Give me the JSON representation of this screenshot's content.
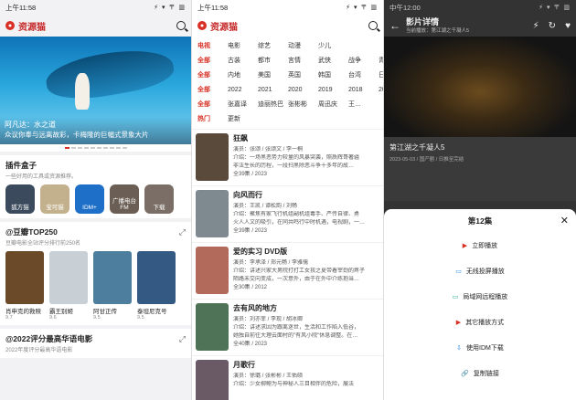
{
  "home": {
    "status_time": "上午11:58",
    "status_right": "⚡ ▾ 〒 ▥",
    "app_title": "资源猫",
    "banner": {
      "title": "阿凡达：水之道",
      "subtitle": "众议你奉与远离故彩，卡梅隆的巨幅式景象大片"
    },
    "plugins": {
      "title": "插件盒子",
      "sub": "一些好用的工具或资源推荐。",
      "items": [
        {
          "label": "狐方猫",
          "color": "#3b4a5c"
        },
        {
          "label": "宝可猫",
          "color": "#c3b18e"
        },
        {
          "label": "IDM+",
          "color": "#1e6fc8"
        },
        {
          "label": "广播电台FM",
          "color": "#6b5e54"
        },
        {
          "label": "下载",
          "color": "#7a6e66"
        }
      ]
    },
    "top250": {
      "title": "@豆瓣TOP250",
      "sub": "豆瓣电影全站评分排行前250名",
      "items": [
        {
          "name": "肖申克的救赎",
          "score": "9.7",
          "color": "#6b4a2a"
        },
        {
          "name": "霸王别姬",
          "score": "9.6",
          "color": "#c8d0d6"
        },
        {
          "name": "阿甘正传",
          "score": "9.5",
          "color": "#4e7e9e"
        },
        {
          "name": "泰坦尼克号",
          "score": "9.5",
          "color": "#345a84"
        }
      ]
    },
    "chinese": {
      "title": "@2022评分最高华语电影",
      "sub": "2022年度评分最高华语电影"
    }
  },
  "list": {
    "status_time": "上午11:58",
    "status_right": "⚡ ▾ 〒 ▥",
    "app_title": "资源猫",
    "filters": [
      [
        "电视",
        "电影",
        "综艺",
        "动漫",
        "少儿"
      ],
      [
        "全部",
        "古装",
        "都市",
        "言情",
        "武侠",
        "战争",
        "青春"
      ],
      [
        "全部",
        "内地",
        "美国",
        "英国",
        "韩国",
        "台湾",
        "日本"
      ],
      [
        "全部",
        "2022",
        "2021",
        "2020",
        "2019",
        "2018",
        "201"
      ],
      [
        "全部",
        "张嘉译",
        "迪丽热巴",
        "张彬彬",
        "周迅庆",
        "王…"
      ],
      [
        "热门",
        "更新"
      ]
    ],
    "movies": [
      {
        "title": "狂飙",
        "cast": "演员：张颂 / 张颂文 / 李一桐",
        "intro": "介绍：一场黑恶势力较量的风暴突袭，照质辉哥著疆",
        "intro2": "非法生长的历程，一段扫黑除恶斗争十多年的故…",
        "meta": "全39集 / 2023",
        "color": "#5a4a3c"
      },
      {
        "title": "向风而行",
        "cast": "演员：王凯 / 谭松韵 / 刘畅",
        "intro": "介绍：聚焦有家飞行机组副机组毒手、严传自律、勇",
        "intro2": "火人人文的吸引，在同共鸣行中时机遇，电视剧，一…",
        "meta": "全39集 / 2023",
        "color": "#7e8a90"
      },
      {
        "title": "爱的实习 DVD版",
        "cast": "演员：李承泽 / 郑元畅 / 李雅儒",
        "intro": "介绍：讲述兴家大男院打打工女孩之夏带着宰劲的疼子",
        "intro2": "陌路未交向变成，一次意外，由于在外中介练抱当…",
        "meta": "全30集 / 2012",
        "color": "#b26a5a"
      },
      {
        "title": "去有风的地方",
        "cast": "演员：刘亦菲 / 李现 / 胡冰卿",
        "intro": "介绍：讲述求因为跟离迷世，生活和工作陷入低谷，",
        "intro2": "她独自前往大理云面村的\"有风小院\"休息调整。在…",
        "meta": "全40集 / 2023",
        "color": "#4f7356"
      },
      {
        "title": "月歌行",
        "cast": "演员：徐璐 / 张彬彬 / 王佑硕",
        "intro": "介绍：少女柳鲍为与神秘人三目相伴的危险，展法",
        "intro2": "",
        "meta": "",
        "color": "#6a5a66"
      }
    ]
  },
  "detail": {
    "status_time": "中午12:00",
    "status_right": "⚡ ▾ 〒 ▥",
    "title": "影片详情",
    "subtitle": "当前播放：第江湖之千凝人5",
    "info_title": "第江湖之千凝人5",
    "info_meta": "2023-05-03 / 国产剧 / 日推至完结",
    "sheet_title": "第12集",
    "actions": [
      {
        "icon": "▶",
        "label": "立即播放",
        "kind": ""
      },
      {
        "icon": "▭",
        "label": "无线投屏播放",
        "kind": "b"
      },
      {
        "icon": "▭",
        "label": "局域网远程播放",
        "kind": "t"
      },
      {
        "icon": "▶",
        "label": "其它播放方式",
        "kind": ""
      },
      {
        "icon": "⇩",
        "label": "使用IDM下载",
        "kind": "b"
      },
      {
        "icon": "🔗",
        "label": "复制链接",
        "kind": "b"
      }
    ]
  }
}
